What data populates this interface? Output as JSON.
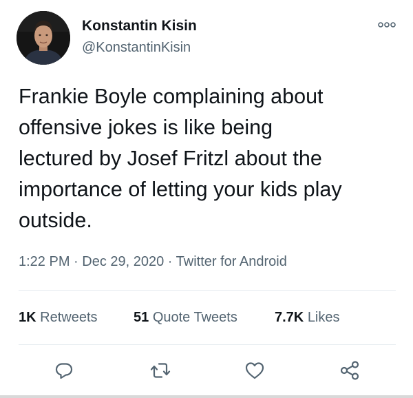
{
  "tweet": {
    "author": {
      "display_name": "Konstantin Kisin",
      "handle": "@KonstantinKisin"
    },
    "text": "Frankie Boyle complaining about\noffensive jokes is like being\nlectured by Josef Fritzl about the\nimportance of letting your kids play\noutside.",
    "meta": "1:22 PM · Dec 29, 2020 · Twitter for Android",
    "stats": {
      "retweets": {
        "count": "1K",
        "label": "Retweets"
      },
      "quote_tweets": {
        "count": "51",
        "label": "Quote Tweets"
      },
      "likes": {
        "count": "7.7K",
        "label": "Likes"
      }
    }
  },
  "icons": {
    "more": "more-options-icon",
    "reply": "reply-icon",
    "retweet": "retweet-icon",
    "like": "heart-icon",
    "share": "share-icon"
  },
  "colors": {
    "text_primary": "#0f1419",
    "text_secondary": "#536471",
    "icon": "#536471",
    "divider": "#e6ecf0"
  }
}
